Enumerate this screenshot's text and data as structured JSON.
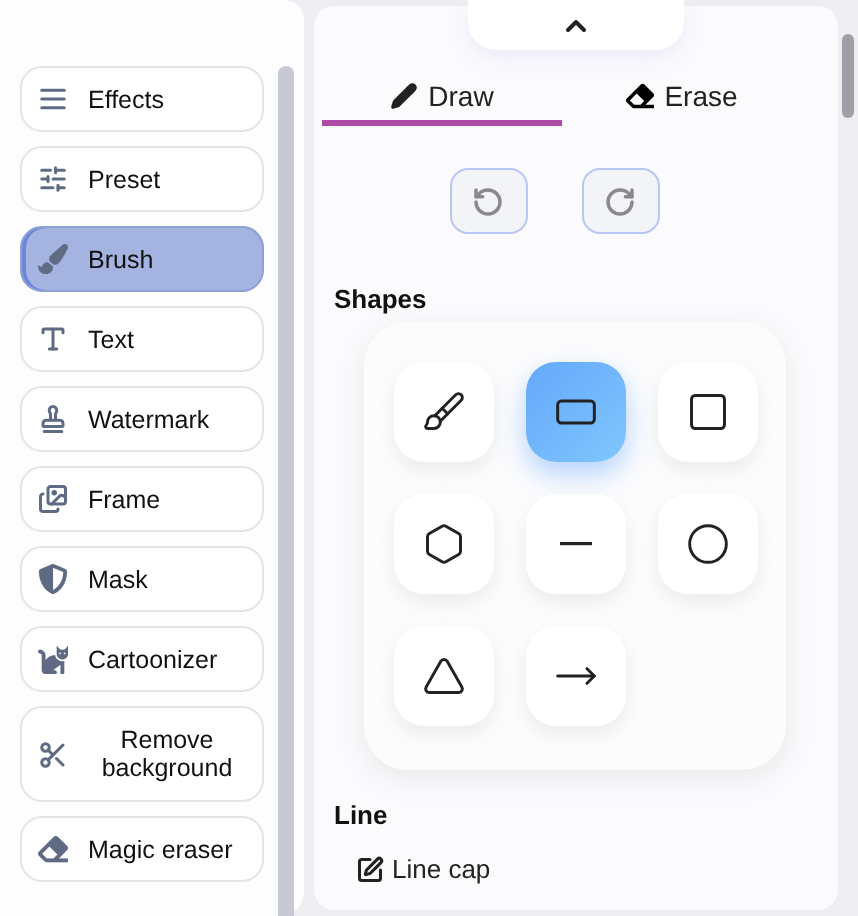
{
  "sidebar": {
    "items": [
      {
        "label": "Effects",
        "kind": "effects",
        "selected": false
      },
      {
        "label": "Preset",
        "kind": "preset",
        "selected": false
      },
      {
        "label": "Brush",
        "kind": "brush",
        "selected": true
      },
      {
        "label": "Text",
        "kind": "text",
        "selected": false
      },
      {
        "label": "Watermark",
        "kind": "watermark",
        "selected": false
      },
      {
        "label": "Frame",
        "kind": "frame",
        "selected": false
      },
      {
        "label": "Mask",
        "kind": "mask",
        "selected": false
      },
      {
        "label": "Cartoonizer",
        "kind": "cartoon",
        "selected": false
      },
      {
        "label": "Remove background",
        "kind": "cut",
        "selected": false
      },
      {
        "label": "Magic eraser",
        "kind": "eraser",
        "selected": false
      }
    ]
  },
  "panel": {
    "tabs": [
      {
        "label": "Draw",
        "kind": "draw",
        "selected": true
      },
      {
        "label": "Erase",
        "kind": "erase",
        "selected": false
      }
    ],
    "shapes_title": "Shapes",
    "shapes": [
      {
        "kind": "brush",
        "selected": false
      },
      {
        "kind": "rectangle",
        "selected": true
      },
      {
        "kind": "square",
        "selected": false
      },
      {
        "kind": "hexagon",
        "selected": false
      },
      {
        "kind": "line",
        "selected": false
      },
      {
        "kind": "circle",
        "selected": false
      },
      {
        "kind": "triangle",
        "selected": false
      },
      {
        "kind": "arrow",
        "selected": false
      }
    ],
    "line_title": "Line",
    "line_cap": "Line cap"
  }
}
